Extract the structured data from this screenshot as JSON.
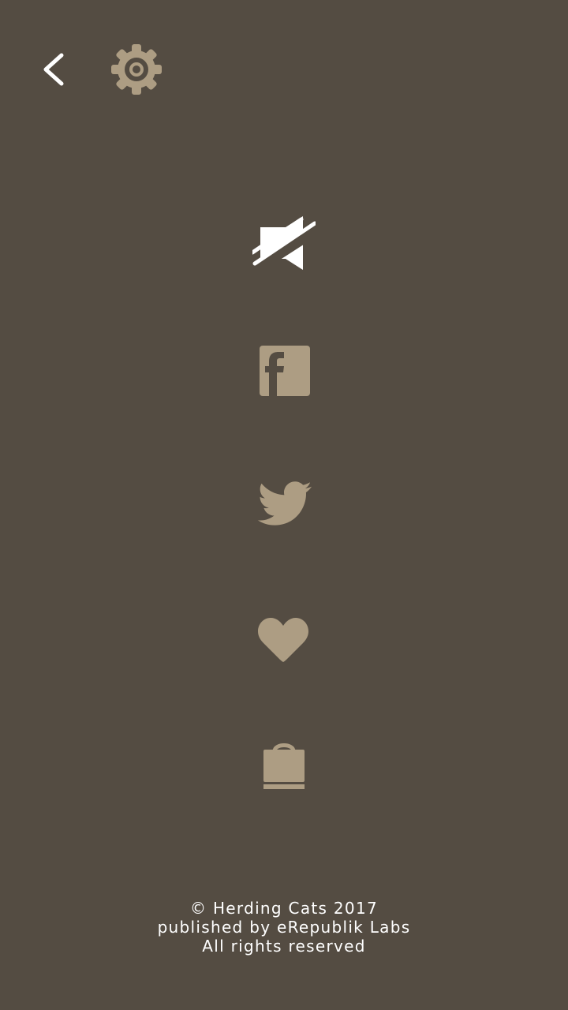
{
  "colors": {
    "background": "#544c42",
    "icon_tan": "#ad9d83",
    "icon_white": "#ffffff",
    "text": "#ffffff"
  },
  "top_bar": {
    "back_icon": "chevron-left-icon",
    "settings_icon": "gear-icon"
  },
  "menu": {
    "sound_icon": "sound-muted-icon",
    "facebook_icon": "facebook-icon",
    "twitter_icon": "twitter-icon",
    "heart_icon": "heart-icon",
    "shop_icon": "shopping-bag-icon"
  },
  "footer": {
    "copyright": "© Herding Cats 2017",
    "publisher": "published by eRepublik Labs",
    "rights": "All rights reserved"
  }
}
